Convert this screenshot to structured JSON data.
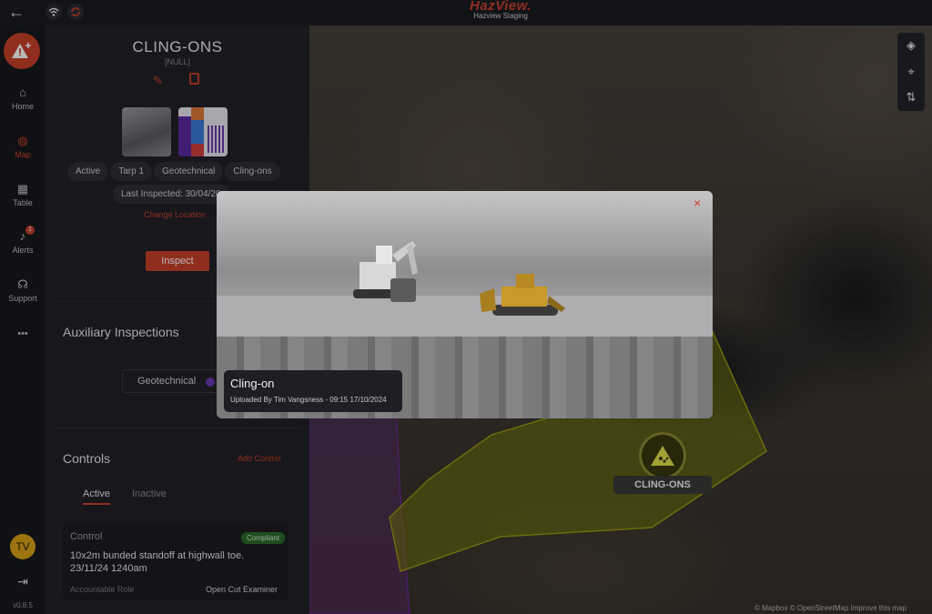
{
  "brand": {
    "logo": "HazView.",
    "environment": "Hazview Staging"
  },
  "nav": {
    "items": [
      {
        "label": "Home",
        "icon": "home-icon"
      },
      {
        "label": "Map",
        "icon": "globe-icon",
        "active": true
      },
      {
        "label": "Table",
        "icon": "table-icon"
      },
      {
        "label": "Alerts",
        "icon": "bell-icon",
        "badge": "1"
      },
      {
        "label": "Support",
        "icon": "headset-icon"
      }
    ],
    "more": "•••",
    "avatar_initials": "TV",
    "version": "v0.8.5"
  },
  "hazard": {
    "title": "CLING-ONS",
    "subtitle": "[NULL]",
    "chips": [
      "Active",
      "Tarp 1",
      "Geotechnical",
      "Cling-ons"
    ],
    "last_inspected": "Last Inspected: 30/04/20",
    "change_location": "Change Location",
    "inspect_label": "Inspect"
  },
  "auxiliary": {
    "title": "Auxiliary Inspections",
    "button": "Geotechnical"
  },
  "controls": {
    "title": "Controls",
    "add_label": "Add Control",
    "tabs": [
      "Active",
      "Inactive"
    ],
    "card": {
      "label": "Control",
      "badge": "Compliant",
      "description": "10x2m bunded standoff at highwall toe.\n23/11/24 1240am",
      "role_label": "Accountable Role",
      "role_value": "Open Cut Examiner"
    }
  },
  "map": {
    "zone_label": "CLING-ONS",
    "attribution": "© Mapbox  © OpenStreetMap  Improve this map"
  },
  "modal": {
    "title": "Cling-on",
    "uploaded": "Uploaded By Tim Vangsness - 09:15 17/10/2024",
    "close": "×"
  },
  "colors": {
    "accent": "#c8402a",
    "zone_fill": "#a4a80f",
    "zone_purple": "#8a3ab8",
    "panel_bg": "#202127",
    "compliant": "#2c6b2c"
  }
}
